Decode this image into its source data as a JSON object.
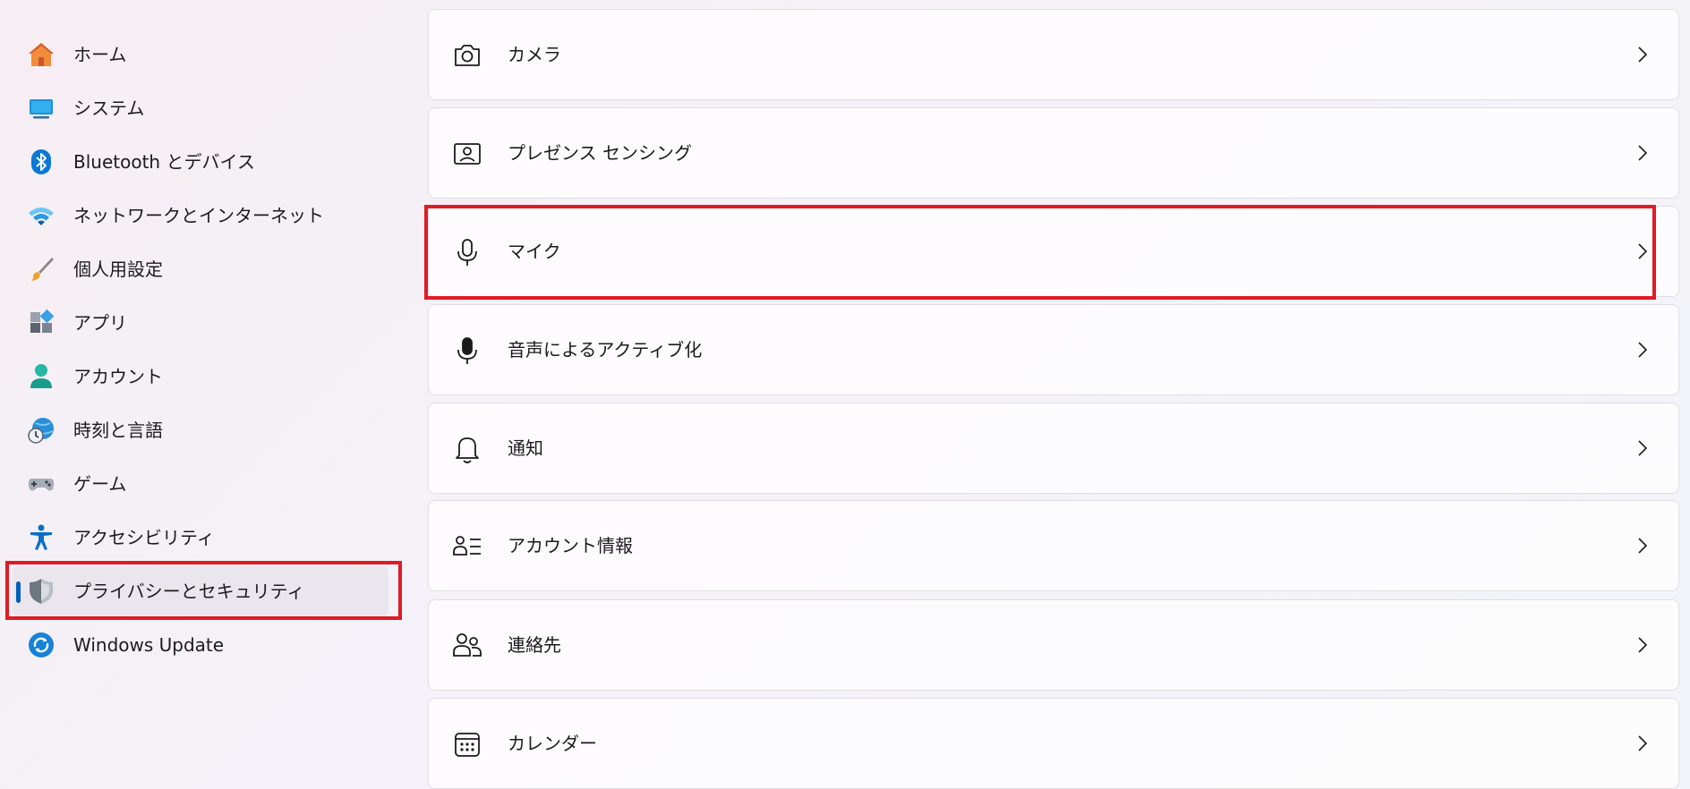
{
  "sidebar": {
    "items": [
      {
        "label": "ホーム",
        "icon": "home-icon"
      },
      {
        "label": "システム",
        "icon": "system-icon"
      },
      {
        "label": "Bluetooth とデバイス",
        "icon": "bluetooth-icon"
      },
      {
        "label": "ネットワークとインターネット",
        "icon": "wifi-icon"
      },
      {
        "label": "個人用設定",
        "icon": "brush-icon"
      },
      {
        "label": "アプリ",
        "icon": "apps-icon"
      },
      {
        "label": "アカウント",
        "icon": "account-icon"
      },
      {
        "label": "時刻と言語",
        "icon": "globe-clock-icon"
      },
      {
        "label": "ゲーム",
        "icon": "gamepad-icon"
      },
      {
        "label": "アクセシビリティ",
        "icon": "accessibility-icon"
      },
      {
        "label": "プライバシーとセキュリティ",
        "icon": "shield-icon",
        "selected": true
      },
      {
        "label": "Windows Update",
        "icon": "update-icon"
      }
    ]
  },
  "main": {
    "items": [
      {
        "label": "カメラ",
        "icon": "camera-icon"
      },
      {
        "label": "プレゼンス センシング",
        "icon": "presence-sensing-icon"
      },
      {
        "label": "マイク",
        "icon": "microphone-icon",
        "highlighted": true
      },
      {
        "label": "音声によるアクティブ化",
        "icon": "voice-activation-icon"
      },
      {
        "label": "通知",
        "icon": "bell-icon"
      },
      {
        "label": "アカウント情報",
        "icon": "account-info-icon"
      },
      {
        "label": "連絡先",
        "icon": "contacts-icon"
      },
      {
        "label": "カレンダー",
        "icon": "calendar-icon"
      }
    ]
  },
  "colors": {
    "accent": "#005fb8",
    "highlight": "#e01b24"
  }
}
